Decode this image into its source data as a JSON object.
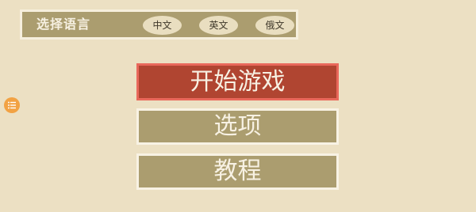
{
  "language_bar": {
    "title": "选择语言",
    "options": [
      "中文",
      "英文",
      "俄文"
    ]
  },
  "menu": {
    "start": "开始游戏",
    "options": "选项",
    "tutorial": "教程"
  },
  "colors": {
    "background": "#ece0c3",
    "panel": "#ab9d6f",
    "start_button": "#b04531",
    "start_border": "#e9685b",
    "menu_icon": "#f2a243"
  },
  "icons": {
    "side_menu": "list-menu-icon"
  }
}
